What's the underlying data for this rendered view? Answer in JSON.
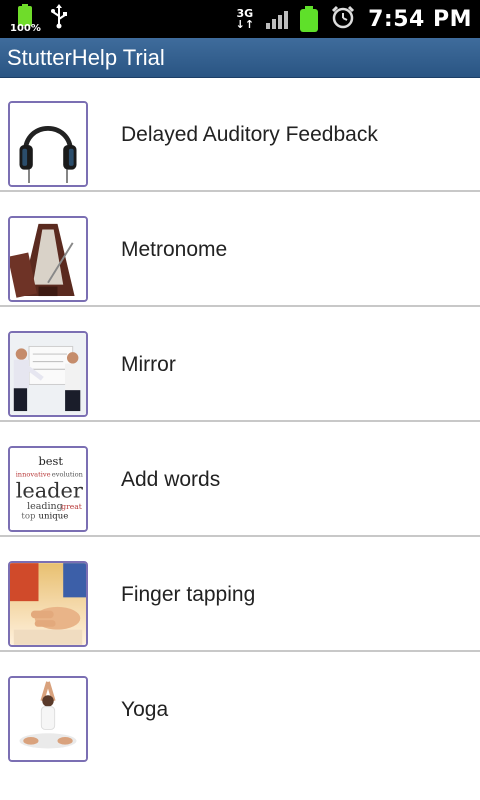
{
  "status_bar": {
    "battery_percent": "100%",
    "network_type": "3G",
    "time": "7:54 PM",
    "icons": [
      "battery-icon",
      "usb-icon",
      "network-type-icon",
      "signal-icon",
      "battery-icon",
      "alarm-icon"
    ]
  },
  "app": {
    "title": "StutterHelp Trial"
  },
  "list": {
    "items": [
      {
        "label": "Delayed Auditory Feedback",
        "icon": "headphones-icon"
      },
      {
        "label": "Metronome",
        "icon": "metronome-icon"
      },
      {
        "label": "Mirror",
        "icon": "presentation-icon"
      },
      {
        "label": "Add words",
        "icon": "word-cloud-icon"
      },
      {
        "label": "Finger tapping",
        "icon": "hand-icon"
      },
      {
        "label": "Yoga",
        "icon": "yoga-icon"
      }
    ]
  },
  "thumbnail_words": {
    "best": "best",
    "leader": "leader",
    "leading": "leading",
    "top": "top",
    "unique": "unique",
    "great": "great",
    "innovative": "innovative",
    "evolution": "evolution"
  }
}
